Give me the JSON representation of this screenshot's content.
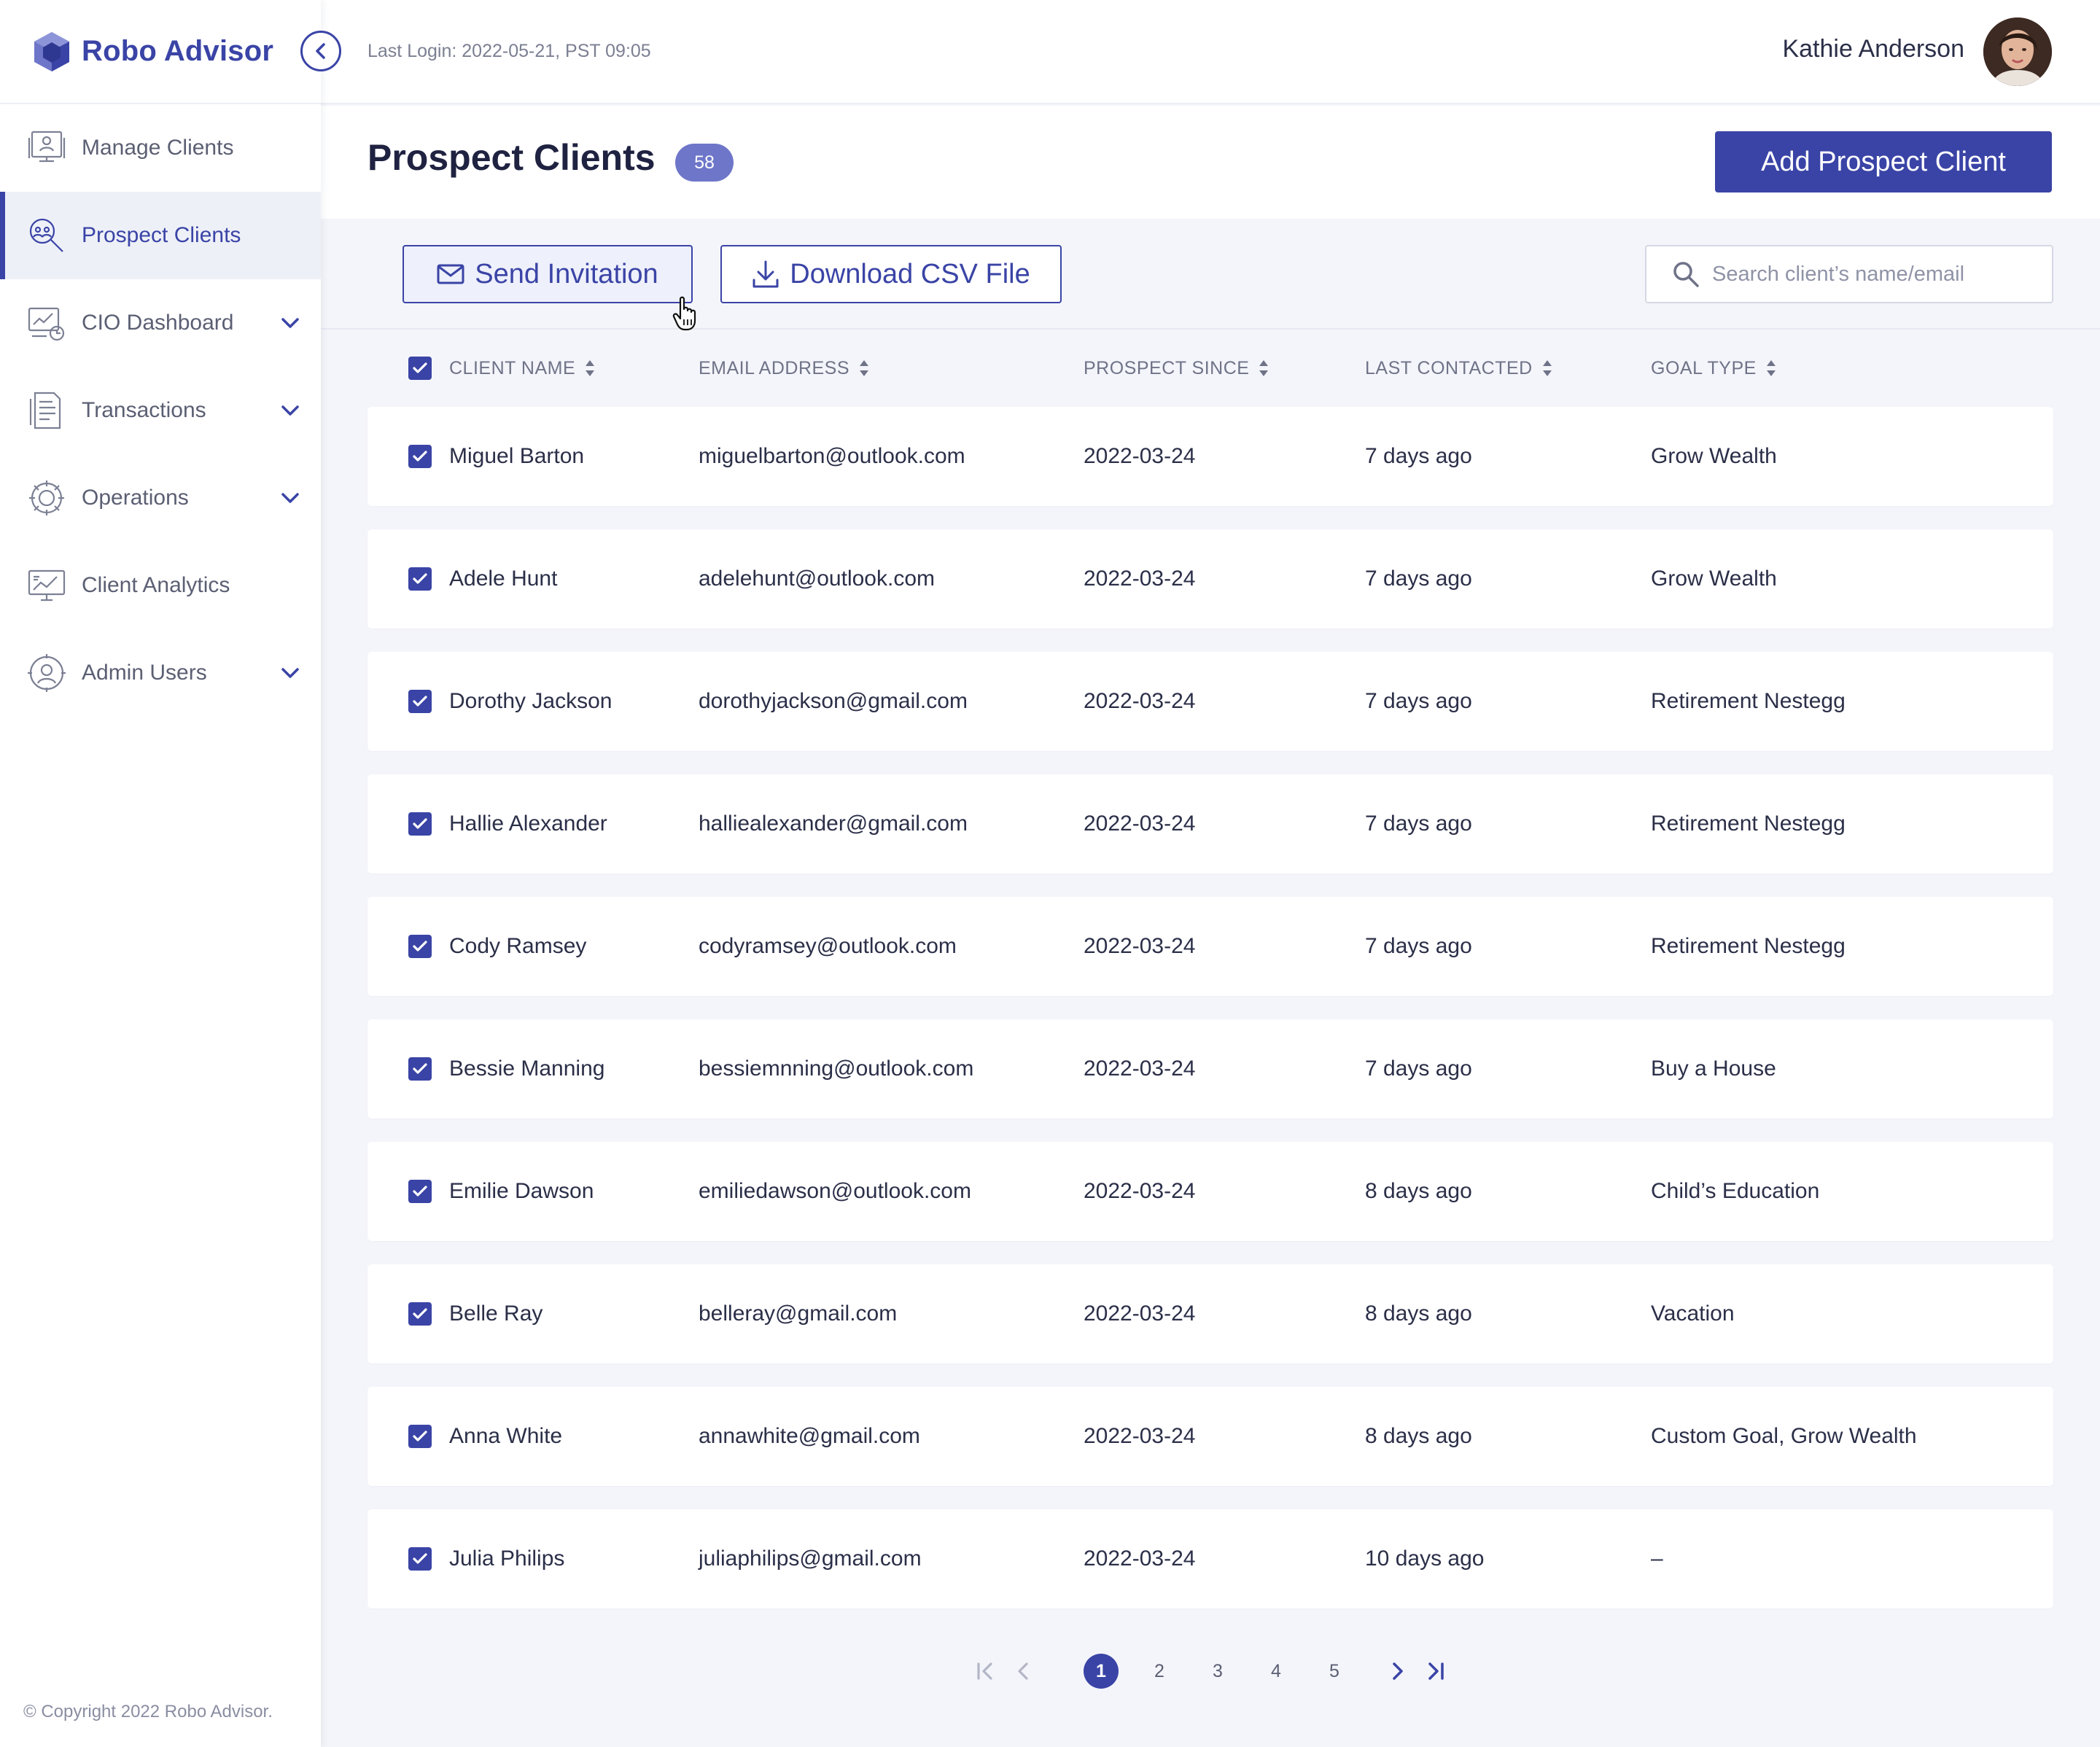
{
  "app": {
    "name": "Robo Advisor",
    "copyright": "© Copyright 2022 Robo Advisor."
  },
  "topbar": {
    "last_login": "Last Login: 2022-05-21, PST 09:05",
    "user_name": "Kathie Anderson"
  },
  "sidebar": {
    "items": [
      {
        "label": "Manage Clients",
        "icon": "manage-clients-icon",
        "active": false,
        "expandable": false
      },
      {
        "label": "Prospect Clients",
        "icon": "prospect-clients-icon",
        "active": true,
        "expandable": false
      },
      {
        "label": "CIO Dashboard",
        "icon": "cio-dashboard-icon",
        "active": false,
        "expandable": true
      },
      {
        "label": "Transactions",
        "icon": "transactions-icon",
        "active": false,
        "expandable": true
      },
      {
        "label": "Operations",
        "icon": "operations-icon",
        "active": false,
        "expandable": true
      },
      {
        "label": "Client Analytics",
        "icon": "client-analytics-icon",
        "active": false,
        "expandable": false
      },
      {
        "label": "Admin Users",
        "icon": "admin-users-icon",
        "active": false,
        "expandable": true
      }
    ]
  },
  "page": {
    "title": "Prospect Clients",
    "count": "58",
    "add_button": "Add Prospect Client"
  },
  "toolbar": {
    "send_invitation": "Send Invitation",
    "download_csv": "Download CSV File",
    "search_placeholder": "Search client’s name/email"
  },
  "table": {
    "columns": [
      "CLIENT NAME",
      "EMAIL ADDRESS",
      "PROSPECT SINCE",
      "LAST CONTACTED",
      "GOAL TYPE"
    ],
    "rows": [
      {
        "name": "Miguel Barton",
        "email": "miguelbarton@outlook.com",
        "since": "2022-03-24",
        "last": "7 days ago",
        "goal": "Grow Wealth"
      },
      {
        "name": "Adele Hunt",
        "email": "adelehunt@outlook.com",
        "since": "2022-03-24",
        "last": "7 days ago",
        "goal": "Grow Wealth"
      },
      {
        "name": "Dorothy Jackson",
        "email": "dorothyjackson@gmail.com",
        "since": "2022-03-24",
        "last": "7 days ago",
        "goal": "Retirement Nestegg"
      },
      {
        "name": "Hallie Alexander",
        "email": "halliealexander@gmail.com",
        "since": "2022-03-24",
        "last": "7 days ago",
        "goal": "Retirement Nestegg"
      },
      {
        "name": "Cody Ramsey",
        "email": "codyramsey@outlook.com",
        "since": "2022-03-24",
        "last": "7 days ago",
        "goal": "Retirement Nestegg"
      },
      {
        "name": "Bessie Manning",
        "email": "bessiemnning@outlook.com",
        "since": "2022-03-24",
        "last": "7 days ago",
        "goal": "Buy a House"
      },
      {
        "name": "Emilie Dawson",
        "email": "emiliedawson@outlook.com",
        "since": "2022-03-24",
        "last": "8 days ago",
        "goal": "Child’s Education"
      },
      {
        "name": "Belle Ray",
        "email": "belleray@gmail.com",
        "since": "2022-03-24",
        "last": "8 days ago",
        "goal": "Vacation"
      },
      {
        "name": "Anna White",
        "email": "annawhite@gmail.com",
        "since": "2022-03-24",
        "last": "8 days ago",
        "goal": "Custom Goal, Grow Wealth"
      },
      {
        "name": "Julia Philips",
        "email": "juliaphilips@gmail.com",
        "since": "2022-03-24",
        "last": "10 days ago",
        "goal": "–"
      }
    ]
  },
  "pagination": {
    "pages": [
      "1",
      "2",
      "3",
      "4",
      "5"
    ],
    "current": "1"
  },
  "colors": {
    "primary": "#3a44a6",
    "badge": "#6e76c9",
    "background": "#f4f5fa"
  }
}
